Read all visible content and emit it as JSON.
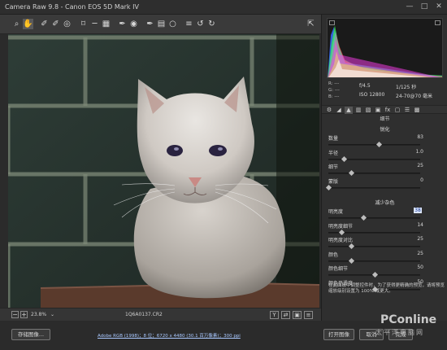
{
  "window": {
    "title": "Camera Raw 9.8 -  Canon EOS 5D Mark IV",
    "minimize": "—",
    "maximize": "□",
    "close": "✕"
  },
  "toolbar": {
    "tools": [
      {
        "name": "zoom-tool-icon",
        "glyph": "⌕"
      },
      {
        "name": "hand-tool-icon",
        "glyph": "✋"
      },
      {
        "name": "white-balance-tool-icon",
        "glyph": "✐"
      },
      {
        "name": "color-sampler-tool-icon",
        "glyph": "✐"
      },
      {
        "name": "targeted-adjustment-tool-icon",
        "glyph": "◎"
      },
      {
        "name": "crop-tool-icon",
        "glyph": "⌑"
      },
      {
        "name": "straighten-tool-icon",
        "glyph": "─"
      },
      {
        "name": "transform-tool-icon",
        "glyph": "▦"
      },
      {
        "name": "spot-removal-tool-icon",
        "glyph": "✒"
      },
      {
        "name": "red-eye-tool-icon",
        "glyph": "◉"
      },
      {
        "name": "adjustment-brush-icon",
        "glyph": "✒"
      },
      {
        "name": "graduated-filter-icon",
        "glyph": "▤"
      },
      {
        "name": "radial-filter-icon",
        "glyph": "○"
      },
      {
        "name": "preferences-icon",
        "glyph": "≡"
      },
      {
        "name": "rotate-left-icon",
        "glyph": "↺"
      },
      {
        "name": "rotate-right-icon",
        "glyph": "↻"
      }
    ],
    "open_fullscreen": "⇱"
  },
  "histogram": {
    "colors": {
      "red": "#ff3b3b",
      "green": "#3bff4a",
      "blue": "#3b6bff",
      "cyan": "#3ff0ff",
      "magenta": "#ff3bf0",
      "yellow": "#ffff3b"
    }
  },
  "meta": {
    "r_label": "R:",
    "g_label": "G:",
    "b_label": "B:",
    "r": "---",
    "g": "---",
    "b": "---",
    "aperture": "f/4.5",
    "shutter": "1/125 秒",
    "iso": "ISO 12800",
    "lens": "24-70@70 毫米"
  },
  "panel_tabs": [
    "basic",
    "tone-curve",
    "detail",
    "hsl",
    "split-toning",
    "lens",
    "fx",
    "camera-calibration",
    "presets",
    "snapshots"
  ],
  "panel_title": "细节",
  "sharpening": {
    "title": "锐化",
    "sliders": [
      {
        "label": "数量",
        "value": "83",
        "fraction": 0.55
      },
      {
        "label": "半径",
        "value": "1.0",
        "fraction": 0.17
      },
      {
        "label": "细节",
        "value": "25",
        "fraction": 0.25
      },
      {
        "label": "蒙版",
        "value": "0",
        "fraction": 0.0
      }
    ]
  },
  "noise_reduction": {
    "title": "减少杂色",
    "sliders": [
      {
        "label": "明亮度",
        "value": "38",
        "fraction": 0.38,
        "focused": true
      },
      {
        "label": "明亮度细节",
        "value": "14",
        "fraction": 0.14
      },
      {
        "label": "明亮度对比",
        "value": "25",
        "fraction": 0.25
      },
      {
        "label": "颜色",
        "value": "25",
        "fraction": 0.25
      },
      {
        "label": "颜色细节",
        "value": "50",
        "fraction": 0.5
      },
      {
        "label": "颜色平滑度",
        "value": "50",
        "fraction": 0.5
      }
    ]
  },
  "help_text": "在此面板中调整控件时，为了获得更精确的预览，请将预览缩放级别设置为 100% 或更大。",
  "status": {
    "zoom_out": "−",
    "zoom_in": "+",
    "zoom_level": "23.8%",
    "filename": "1Q6A0137.CR2",
    "view_buttons": [
      "Y",
      "⇄",
      "▣",
      "≡"
    ]
  },
  "footer": {
    "save_image": "存储图像...",
    "workflow": "Adobe RGB (1998)；8 位；6720 x 4480 (30.1 百万像素)；300 ppi",
    "open_image": "打开图像",
    "cancel": "取消",
    "done": "完成"
  },
  "watermark": {
    "brand": "PConline",
    "tag": "太平洋电脑网"
  }
}
